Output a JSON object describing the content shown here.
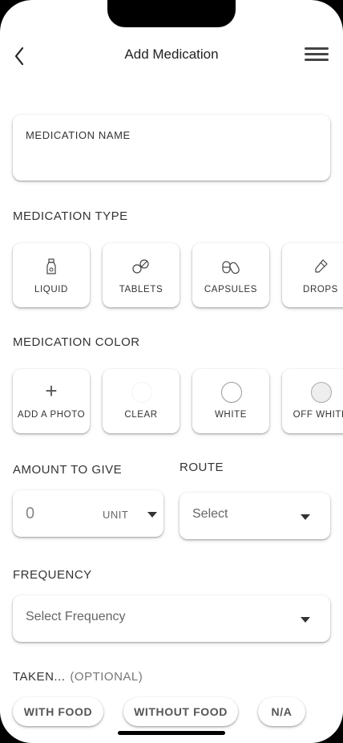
{
  "header": {
    "title": "Add Medication",
    "back_icon": "chevron-left-icon",
    "menu_icon": "hamburger-menu-icon"
  },
  "medication_name": {
    "label": "MEDICATION NAME",
    "value": ""
  },
  "medication_type": {
    "label": "MEDICATION TYPE",
    "options": [
      {
        "label": "LIQUID",
        "icon": "bottle-icon"
      },
      {
        "label": "TABLETS",
        "icon": "tablets-icon"
      },
      {
        "label": "CAPSULES",
        "icon": "capsules-icon"
      },
      {
        "label": "DROPS",
        "icon": "dropper-icon"
      }
    ]
  },
  "medication_color": {
    "label": "MEDICATION COLOR",
    "add_photo_label": "ADD A PHOTO",
    "options": [
      {
        "label": "CLEAR",
        "color": "#ffffff"
      },
      {
        "label": "WHITE",
        "color": "#ffffff"
      },
      {
        "label": "OFF WHITE",
        "color": "#eeeeee"
      }
    ]
  },
  "amount": {
    "label": "AMOUNT TO GIVE",
    "value": "0",
    "unit_label": "UNIT"
  },
  "route": {
    "label": "ROUTE",
    "placeholder": "Select"
  },
  "frequency": {
    "label": "FREQUENCY",
    "placeholder": "Select Frequency"
  },
  "taken": {
    "label": "TAKEN...",
    "optional_label": "(OPTIONAL)",
    "options": [
      "WITH FOOD",
      "WITHOUT FOOD",
      "N/A"
    ]
  },
  "colors": {
    "background": "#ffffff",
    "text": "#333333",
    "muted_text": "#777777"
  }
}
